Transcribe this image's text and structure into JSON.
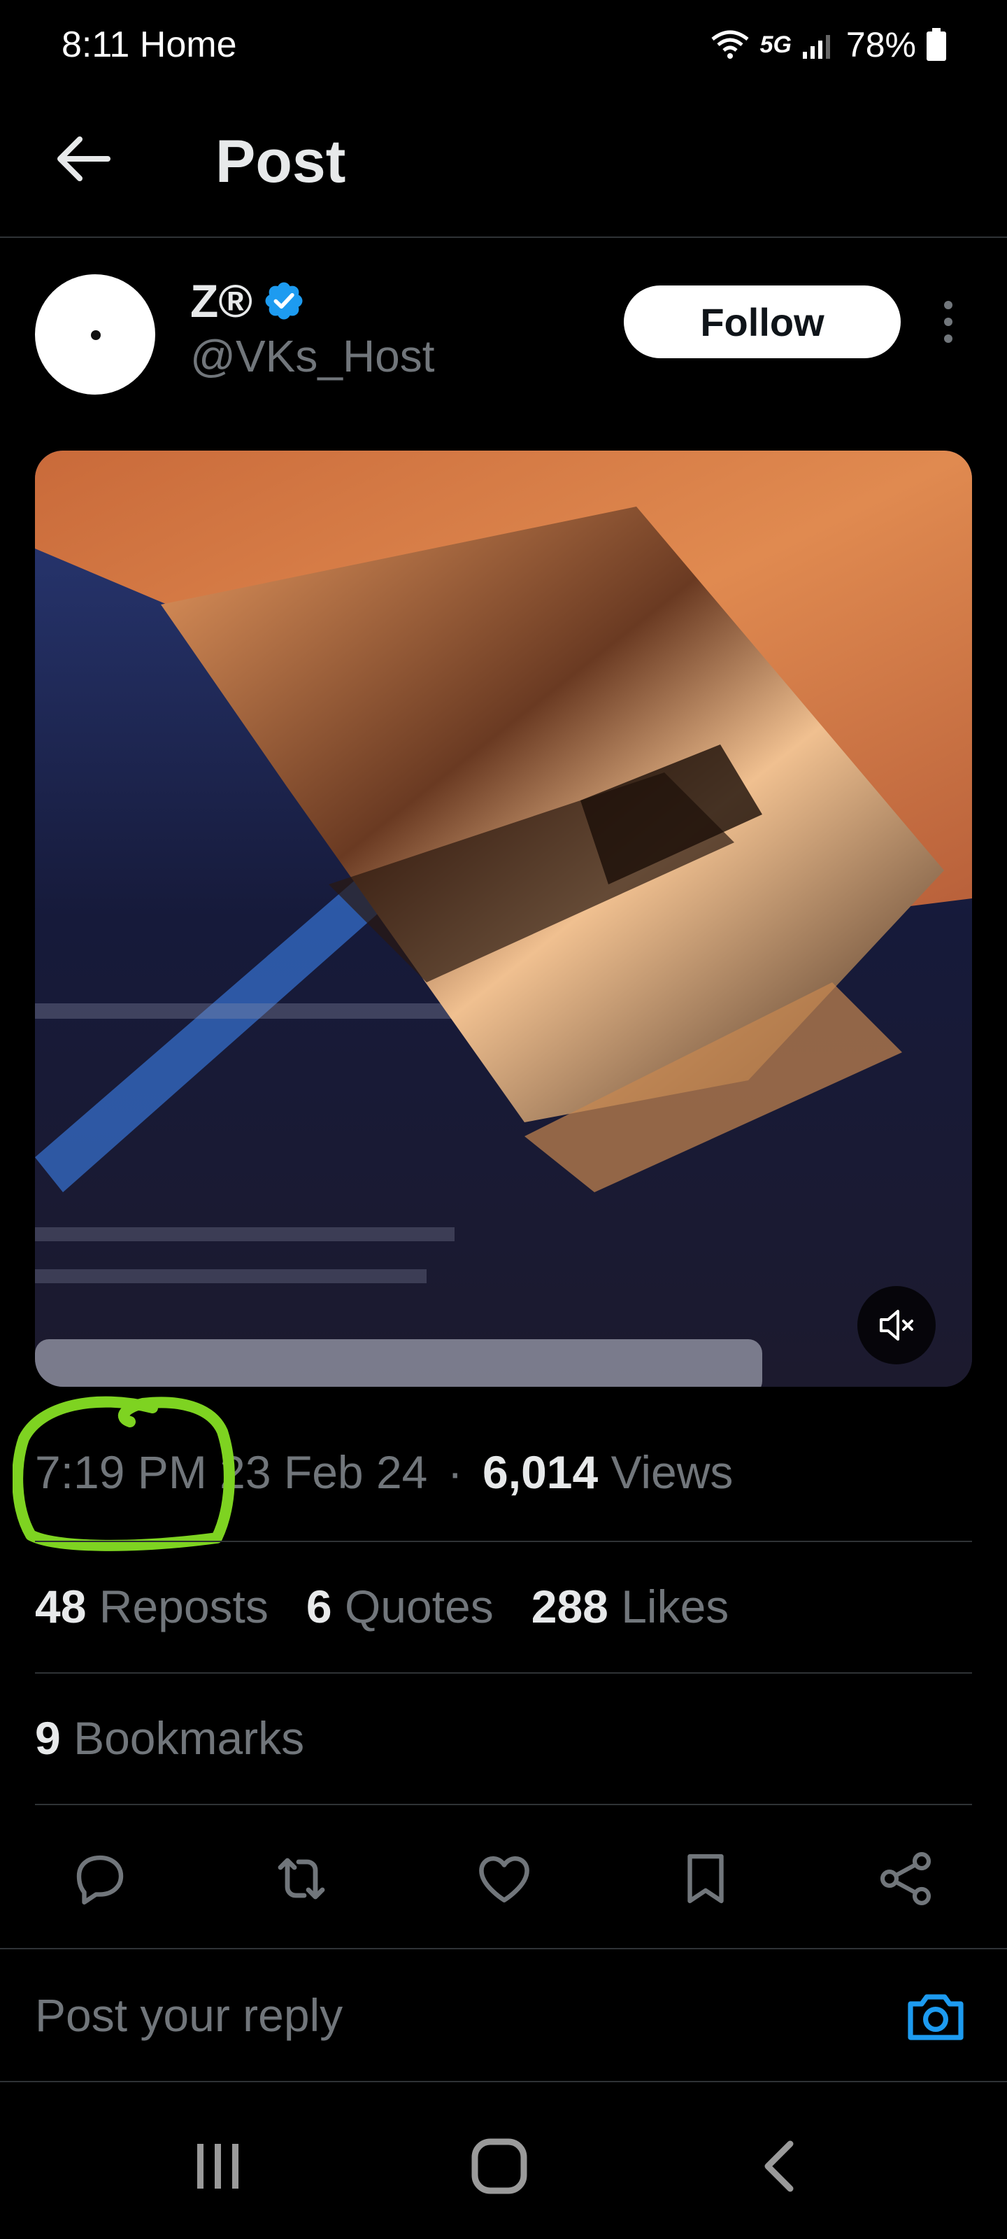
{
  "status_bar": {
    "time_label": "8:11 Home",
    "network": "5G",
    "battery": "78%"
  },
  "header": {
    "title": "Post"
  },
  "post": {
    "author": {
      "name": "Z®",
      "handle": "@VKs_Host",
      "verified": true
    },
    "follow_label": "Follow",
    "time": "7:19 PM",
    "date": "23 Feb 24",
    "separator": "·",
    "views_count": "6,014",
    "views_label": "Views",
    "stats": {
      "reposts_count": "48",
      "reposts_label": "Reposts",
      "quotes_count": "6",
      "quotes_label": "Quotes",
      "likes_count": "288",
      "likes_label": "Likes",
      "bookmarks_count": "9",
      "bookmarks_label": "Bookmarks"
    }
  },
  "reply": {
    "placeholder": "Post your reply"
  },
  "colors": {
    "accent": "#1d9bf0",
    "annotation": "#7ed321",
    "muted_text": "#71767b",
    "background": "#000000"
  },
  "icons": [
    "back-arrow-icon",
    "verified-badge-icon",
    "more-vertical-icon",
    "mute-icon",
    "reply-icon",
    "repost-icon",
    "like-icon",
    "bookmark-icon",
    "share-icon",
    "camera-icon",
    "recents-icon",
    "home-icon",
    "nav-back-icon"
  ]
}
